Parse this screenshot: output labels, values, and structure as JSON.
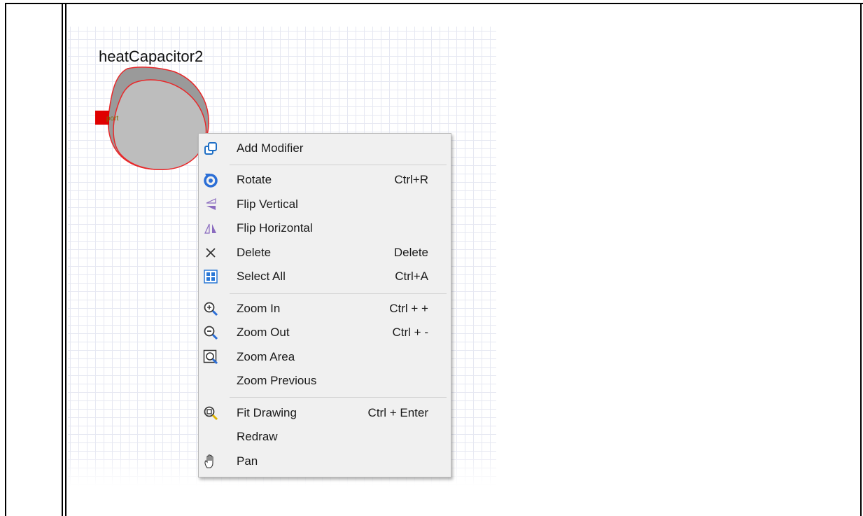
{
  "diagram": {
    "component_name": "heatCapacitor2",
    "port_label": "port",
    "colors": {
      "fill": "#bdbdbd",
      "outline": "#e8282a",
      "port": "#e00000",
      "grid": "#e6e8f2"
    }
  },
  "context_menu": {
    "items": [
      {
        "label": "Add Modifier",
        "shortcut": "",
        "icon": "add-modifier-icon"
      },
      {
        "label": "Rotate",
        "shortcut": "Ctrl+R",
        "icon": "rotate-icon"
      },
      {
        "label": "Flip Vertical",
        "shortcut": "",
        "icon": "flip-vertical-icon"
      },
      {
        "label": "Flip Horizontal",
        "shortcut": "",
        "icon": "flip-horizontal-icon"
      },
      {
        "label": "Delete",
        "shortcut": "Delete",
        "icon": "delete-icon"
      },
      {
        "label": "Select All",
        "shortcut": "Ctrl+A",
        "icon": "select-all-icon"
      },
      {
        "label": "Zoom In",
        "shortcut": "Ctrl + +",
        "icon": "zoom-in-icon"
      },
      {
        "label": "Zoom Out",
        "shortcut": "Ctrl + -",
        "icon": "zoom-out-icon"
      },
      {
        "label": "Zoom Area",
        "shortcut": "",
        "icon": "zoom-area-icon"
      },
      {
        "label": "Zoom Previous",
        "shortcut": "",
        "icon": ""
      },
      {
        "label": "Fit Drawing",
        "shortcut": "Ctrl + Enter",
        "icon": "fit-drawing-icon"
      },
      {
        "label": "Redraw",
        "shortcut": "",
        "icon": ""
      },
      {
        "label": "Pan",
        "shortcut": "",
        "icon": "pan-icon"
      }
    ]
  }
}
